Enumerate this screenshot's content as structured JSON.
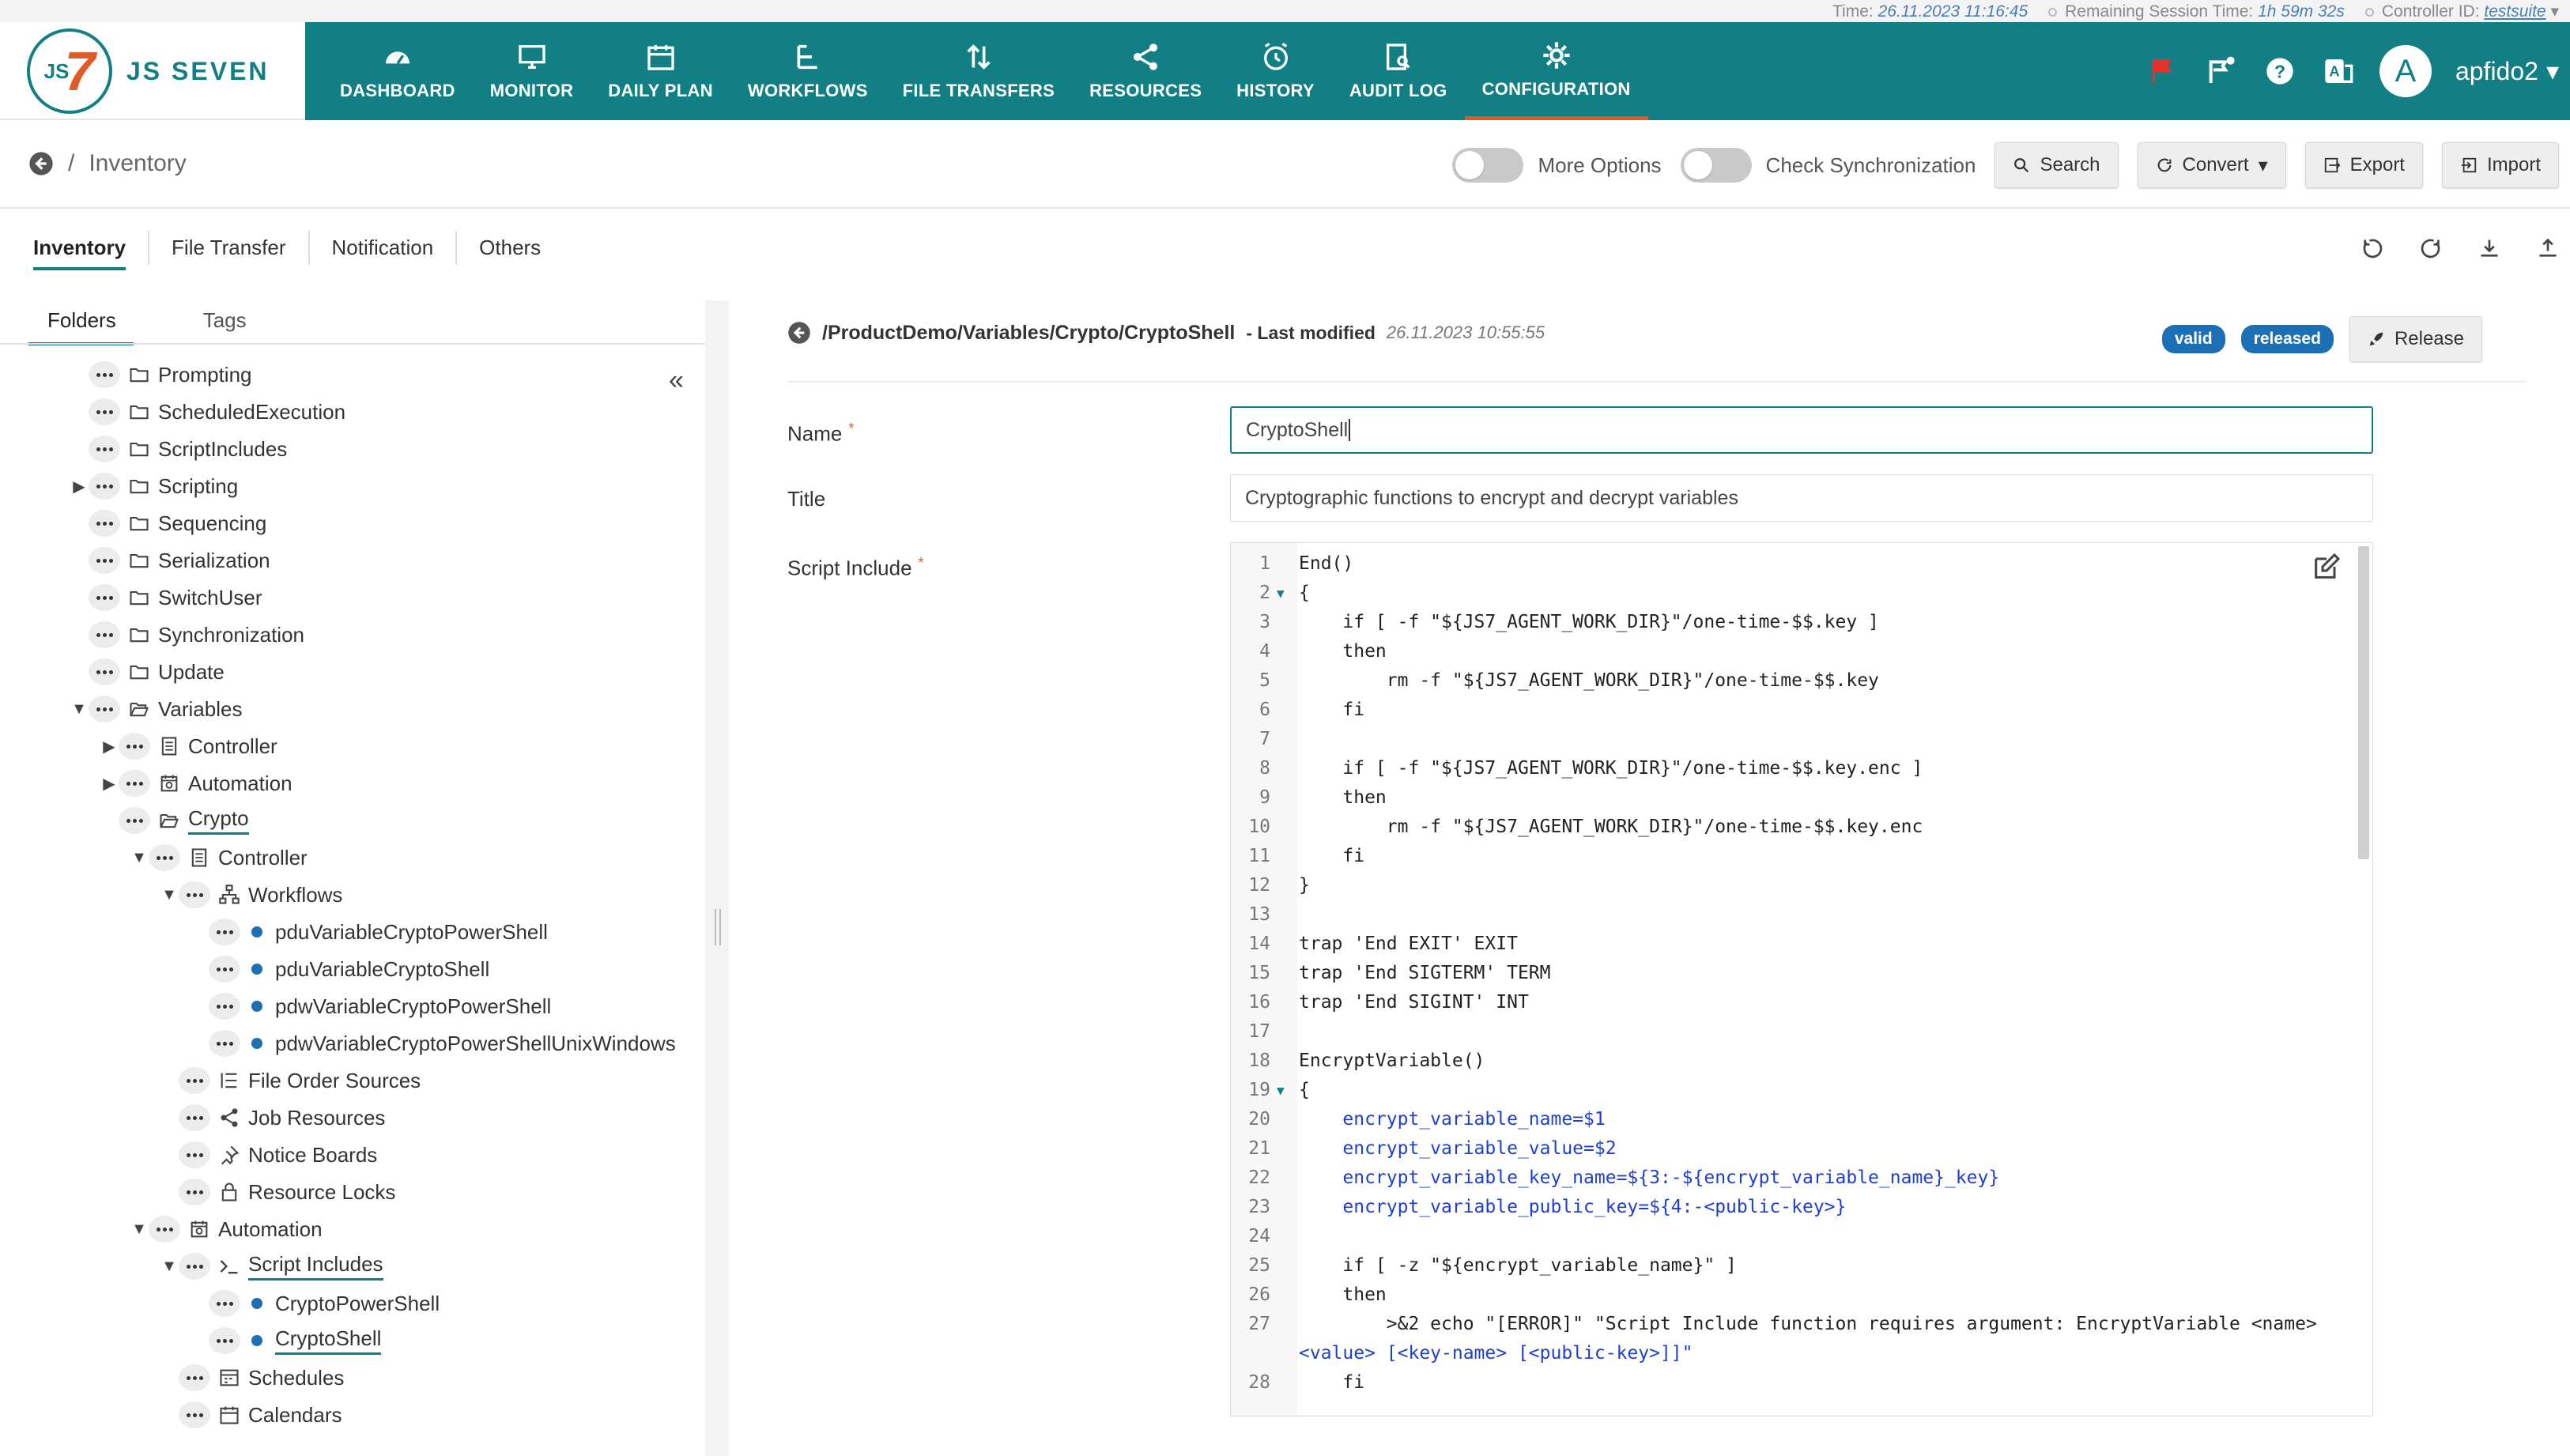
{
  "status_bar": {
    "time_label": "Time:",
    "time_value": "26.11.2023 11:16:45",
    "session_label": "Remaining Session Time:",
    "session_value": "1h 59m 32s",
    "controller_label": "Controller ID:",
    "controller_value": "testsuite"
  },
  "brand": {
    "logo_text": "JS SEVEN",
    "logo_mark_js": "JS",
    "logo_mark_seven": "7"
  },
  "nav": [
    {
      "label": "DASHBOARD",
      "icon": "dashboard-icon"
    },
    {
      "label": "MONITOR",
      "icon": "monitor-icon"
    },
    {
      "label": "DAILY PLAN",
      "icon": "calendar-icon"
    },
    {
      "label": "WORKFLOWS",
      "icon": "workflow-icon"
    },
    {
      "label": "FILE TRANSFERS",
      "icon": "transfer-icon"
    },
    {
      "label": "RESOURCES",
      "icon": "share-icon"
    },
    {
      "label": "HISTORY",
      "icon": "clock-icon"
    },
    {
      "label": "AUDIT LOG",
      "icon": "audit-icon"
    },
    {
      "label": "CONFIGURATION",
      "icon": "gear-icon",
      "active": true
    }
  ],
  "user": {
    "avatar_letter": "A",
    "name": "apfido2"
  },
  "breadcrumb": {
    "separator": "/",
    "title": "Inventory"
  },
  "toolbar": {
    "more_options": "More Options",
    "check_sync": "Check Synchronization",
    "search": "Search",
    "convert": "Convert",
    "export": "Export",
    "import": "Import"
  },
  "tabs": [
    "Inventory",
    "File Transfer",
    "Notification",
    "Others"
  ],
  "left_tabs": [
    "Folders",
    "Tags"
  ],
  "tree": [
    {
      "label": "Prompting",
      "icon": "folder-icon",
      "depth": 0,
      "caret": ""
    },
    {
      "label": "ScheduledExecution",
      "icon": "folder-icon",
      "depth": 0,
      "caret": ""
    },
    {
      "label": "ScriptIncludes",
      "icon": "folder-icon",
      "depth": 0,
      "caret": ""
    },
    {
      "label": "Scripting",
      "icon": "folder-icon",
      "depth": 0,
      "caret": "right"
    },
    {
      "label": "Sequencing",
      "icon": "folder-icon",
      "depth": 0,
      "caret": ""
    },
    {
      "label": "Serialization",
      "icon": "folder-icon",
      "depth": 0,
      "caret": ""
    },
    {
      "label": "SwitchUser",
      "icon": "folder-icon",
      "depth": 0,
      "caret": ""
    },
    {
      "label": "Synchronization",
      "icon": "folder-icon",
      "depth": 0,
      "caret": ""
    },
    {
      "label": "Update",
      "icon": "folder-icon",
      "depth": 0,
      "caret": ""
    },
    {
      "label": "Variables",
      "icon": "folder-open-icon",
      "depth": 0,
      "caret": "down"
    },
    {
      "label": "Controller",
      "icon": "controller-icon",
      "depth": 1,
      "caret": "right"
    },
    {
      "label": "Automation",
      "icon": "automation-icon",
      "depth": 1,
      "caret": "right"
    },
    {
      "label": "Crypto",
      "icon": "folder-open-icon",
      "depth": 1,
      "caret": "",
      "selected": true
    },
    {
      "label": "Controller",
      "icon": "controller-icon",
      "depth": 2,
      "caret": "down"
    },
    {
      "label": "Workflows",
      "icon": "workflow-icon",
      "depth": 3,
      "caret": "down"
    },
    {
      "label": "pduVariableCryptoPowerShell",
      "icon": "bullet",
      "depth": 4,
      "caret": ""
    },
    {
      "label": "pduVariableCryptoShell",
      "icon": "bullet",
      "depth": 4,
      "caret": ""
    },
    {
      "label": "pdwVariableCryptoPowerShell",
      "icon": "bullet",
      "depth": 4,
      "caret": ""
    },
    {
      "label": "pdwVariableCryptoPowerShellUnixWindows",
      "icon": "bullet",
      "depth": 4,
      "caret": ""
    },
    {
      "label": "File Order Sources",
      "icon": "list-icon",
      "depth": 3,
      "caret": ""
    },
    {
      "label": "Job Resources",
      "icon": "share-icon",
      "depth": 3,
      "caret": ""
    },
    {
      "label": "Notice Boards",
      "icon": "pin-icon",
      "depth": 3,
      "caret": ""
    },
    {
      "label": "Resource Locks",
      "icon": "lock-icon",
      "depth": 3,
      "caret": ""
    },
    {
      "label": "Automation",
      "icon": "automation-icon",
      "depth": 2,
      "caret": "down"
    },
    {
      "label": "Script Includes",
      "icon": "terminal-icon",
      "depth": 3,
      "caret": "down",
      "underline": true
    },
    {
      "label": "CryptoPowerShell",
      "icon": "bullet",
      "depth": 4,
      "caret": ""
    },
    {
      "label": "CryptoShell",
      "icon": "bullet",
      "depth": 4,
      "caret": "",
      "selected": true
    },
    {
      "label": "Schedules",
      "icon": "schedule-icon",
      "depth": 3,
      "caret": ""
    },
    {
      "label": "Calendars",
      "icon": "calendar-icon",
      "depth": 3,
      "caret": ""
    }
  ],
  "detail": {
    "path": "/ProductDemo/Variables/Crypto/CryptoShell",
    "last_modified_label": "- Last modified",
    "last_modified_value": "26.11.2023 10:55:55",
    "badge_valid": "valid",
    "badge_released": "released",
    "release_button": "Release",
    "name_label": "Name",
    "name_value": "CryptoShell",
    "title_label": "Title",
    "title_value": "Cryptographic functions to encrypt and decrypt variables",
    "script_label": "Script Include"
  },
  "code": [
    {
      "n": "1",
      "t": "End()",
      "c": ""
    },
    {
      "n": "2",
      "t": "{",
      "c": "",
      "fold": true
    },
    {
      "n": "3",
      "t": "    if [ -f \"${JS7_AGENT_WORK_DIR}\"/one-time-$$.key ]",
      "c": ""
    },
    {
      "n": "4",
      "t": "    then",
      "c": ""
    },
    {
      "n": "5",
      "t": "        rm -f \"${JS7_AGENT_WORK_DIR}\"/one-time-$$.key",
      "c": ""
    },
    {
      "n": "6",
      "t": "    fi",
      "c": ""
    },
    {
      "n": "7",
      "t": "",
      "c": ""
    },
    {
      "n": "8",
      "t": "    if [ -f \"${JS7_AGENT_WORK_DIR}\"/one-time-$$.key.enc ]",
      "c": ""
    },
    {
      "n": "9",
      "t": "    then",
      "c": ""
    },
    {
      "n": "10",
      "t": "        rm -f \"${JS7_AGENT_WORK_DIR}\"/one-time-$$.key.enc",
      "c": ""
    },
    {
      "n": "11",
      "t": "    fi",
      "c": ""
    },
    {
      "n": "12",
      "t": "}",
      "c": ""
    },
    {
      "n": "13",
      "t": "",
      "c": ""
    },
    {
      "n": "14",
      "t": "trap 'End EXIT' EXIT",
      "c": ""
    },
    {
      "n": "15",
      "t": "trap 'End SIGTERM' TERM",
      "c": ""
    },
    {
      "n": "16",
      "t": "trap 'End SIGINT' INT",
      "c": ""
    },
    {
      "n": "17",
      "t": "",
      "c": ""
    },
    {
      "n": "18",
      "t": "EncryptVariable()",
      "c": ""
    },
    {
      "n": "19",
      "t": "{",
      "c": "",
      "fold": true
    },
    {
      "n": "20",
      "t": "    encrypt_variable_name=$1",
      "c": "blue"
    },
    {
      "n": "21",
      "t": "    encrypt_variable_value=$2",
      "c": "blue"
    },
    {
      "n": "22",
      "t": "    encrypt_variable_key_name=${3:-${encrypt_variable_name}_key}",
      "c": "blue"
    },
    {
      "n": "23",
      "t": "    encrypt_variable_public_key=${4:-<public-key>}",
      "c": "blue"
    },
    {
      "n": "24",
      "t": "",
      "c": ""
    },
    {
      "n": "25",
      "t": "    if [ -z \"${encrypt_variable_name}\" ]",
      "c": ""
    },
    {
      "n": "26",
      "t": "    then",
      "c": ""
    },
    {
      "n": "27",
      "t": "        >&2 echo \"[ERROR]\" \"Script Include function requires argument: EncryptVariable <name>",
      "c": ""
    },
    {
      "n": "",
      "t": "<value> [<key-name> [<public-key>]]\"",
      "c": "wrap"
    },
    {
      "n": "28",
      "t": "    fi",
      "c": ""
    }
  ],
  "colors": {
    "header": "#127f85",
    "accent": "#e05a28",
    "badge": "#1a6fb5"
  }
}
